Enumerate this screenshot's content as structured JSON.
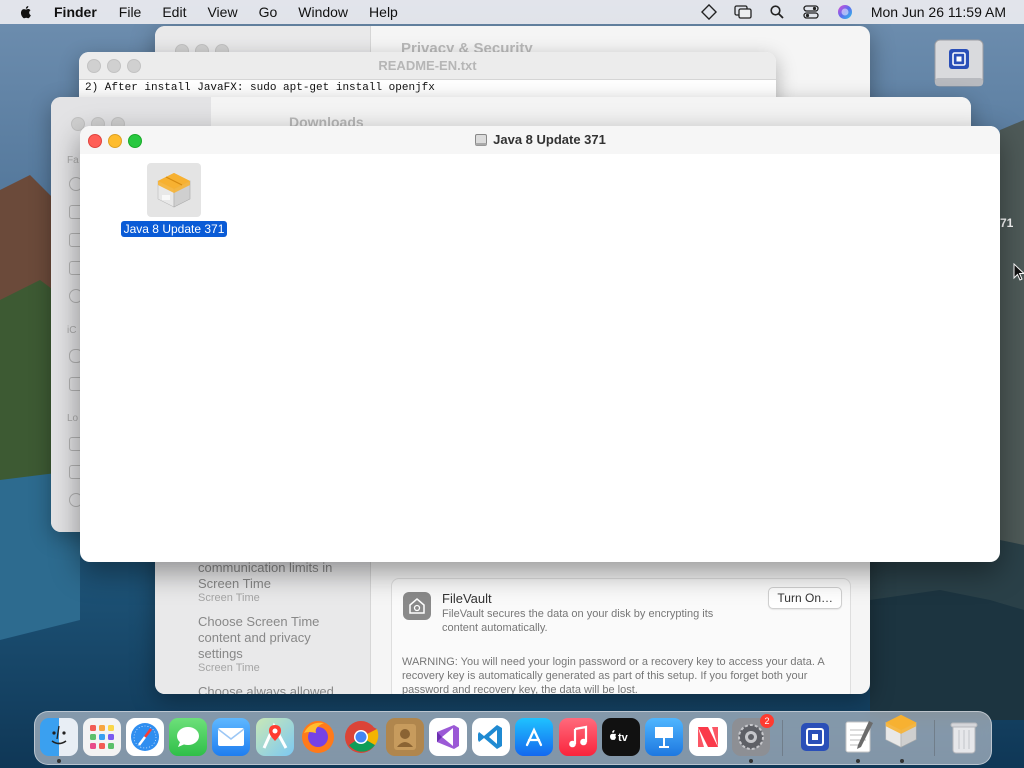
{
  "menubar": {
    "app_name": "Finder",
    "menus": [
      "File",
      "Edit",
      "View",
      "Go",
      "Window",
      "Help"
    ],
    "clock": "Mon Jun 26  11:59 AM"
  },
  "desktop": {
    "partial_label": "71"
  },
  "settings_window": {
    "title": "Privacy & Security",
    "sidebar_items": [
      {
        "label": "communication limits in Screen Time",
        "sub": "Screen Time"
      },
      {
        "label": "Choose Screen Time content and privacy settings",
        "sub": "Screen Time"
      },
      {
        "label": "Choose always allowed"
      }
    ],
    "filevault": {
      "title": "FileVault",
      "description": "FileVault secures the data on your disk by encrypting its content automatically.",
      "button": "Turn On…",
      "warning": "WARNING: You will need your login password or a recovery key to access your data. A recovery key is automatically generated as part of this setup. If you forget both your password and recovery key, the data will be lost."
    }
  },
  "readme_window": {
    "title": "README-EN.txt",
    "lines": [
      "2) After install JavaFX: sudo apt-get install openjfx"
    ]
  },
  "downloads_window": {
    "title": "Downloads",
    "sidebar_sections": [
      "Fa",
      "iC",
      "Lo"
    ]
  },
  "java_window": {
    "title": "Java 8 Update 371",
    "items": [
      {
        "label": "Java 8 Update 371",
        "selected": true
      }
    ]
  },
  "dock": {
    "items": [
      {
        "name": "Finder",
        "running": true
      },
      {
        "name": "Launchpad"
      },
      {
        "name": "Safari"
      },
      {
        "name": "Messages"
      },
      {
        "name": "Mail"
      },
      {
        "name": "Maps"
      },
      {
        "name": "Firefox"
      },
      {
        "name": "Chrome"
      },
      {
        "name": "Contacts"
      },
      {
        "name": "Visual Studio"
      },
      {
        "name": "VS Code"
      },
      {
        "name": "App Store"
      },
      {
        "name": "Music"
      },
      {
        "name": "TV"
      },
      {
        "name": "Keynote"
      },
      {
        "name": "News"
      },
      {
        "name": "System Settings",
        "badge": "2",
        "running": true
      },
      {
        "name": "Disk Image"
      },
      {
        "name": "TextEdit",
        "running": true
      },
      {
        "name": "Java Installer",
        "running": true
      },
      {
        "name": "Trash"
      }
    ]
  },
  "colors": {
    "selection": "#0a5bd6",
    "close": "#ff5f57",
    "minimize": "#febc2e",
    "zoom": "#28c840"
  }
}
